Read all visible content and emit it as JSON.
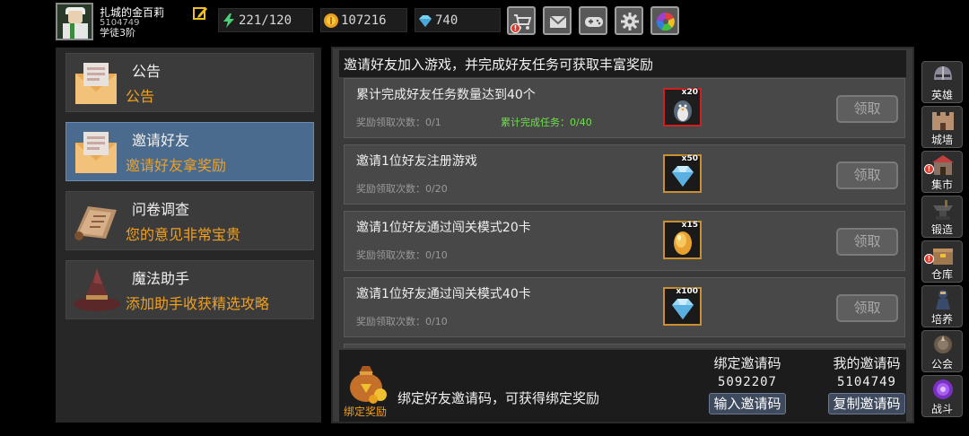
{
  "player": {
    "name": "扎城的金百莉",
    "id": "5104749",
    "group": "学徒3阶"
  },
  "resources": {
    "energy": "221/120",
    "gold": "107216",
    "gems": "740"
  },
  "toolbar": {
    "buttons": [
      "shop-icon",
      "mail-icon",
      "gamepad-icon",
      "gear-icon",
      "color-wheel-icon"
    ]
  },
  "sidebar": {
    "items": [
      {
        "title": "公告",
        "subtitle": "公告"
      },
      {
        "title": "邀请好友",
        "subtitle": "邀请好友拿奖励"
      },
      {
        "title": "问卷调查",
        "subtitle": "您的意见非常宝贵"
      },
      {
        "title": "魔法助手",
        "subtitle": "添加助手收获精选攻略"
      }
    ]
  },
  "main": {
    "header": "邀请好友加入游戏，并完成好友任务可获取丰富奖励",
    "tasks": [
      {
        "title": "累计完成好友任务数量达到40个",
        "claims": "奖励领取次数：0/1",
        "progress": "累计完成任务：0/40",
        "reward_qty": "x20",
        "reward_icon": "penguin-icon",
        "button": "领取"
      },
      {
        "title": "邀请1位好友注册游戏",
        "claims": "奖励领取次数：0/20",
        "reward_qty": "x50",
        "reward_icon": "diamond-icon",
        "button": "领取"
      },
      {
        "title": "邀请1位好友通过闯关模式20卡",
        "claims": "奖励领取次数：0/10",
        "reward_qty": "x15",
        "reward_icon": "golden-egg-icon",
        "button": "领取"
      },
      {
        "title": "邀请1位好友通过闯关模式40卡",
        "claims": "奖励领取次数：0/10",
        "reward_qty": "x100",
        "reward_icon": "diamond-icon",
        "button": "领取"
      }
    ],
    "bottom": {
      "bag_label": "绑定奖励",
      "bind_desc": "绑定好友邀请码，可获得绑定奖励",
      "bind_code_label": "绑定邀请码",
      "bind_code": "5092207",
      "bind_button": "输入邀请码",
      "my_code_label": "我的邀请码",
      "my_code": "5104749",
      "copy_button": "复制邀请码"
    }
  },
  "rightnav": {
    "items": [
      {
        "label": "英雄",
        "icon": "helmet-icon",
        "alert": false
      },
      {
        "label": "城墙",
        "icon": "wall-icon",
        "alert": false
      },
      {
        "label": "集市",
        "icon": "market-icon",
        "alert": true
      },
      {
        "label": "锻造",
        "icon": "anvil-icon",
        "alert": false
      },
      {
        "label": "仓库",
        "icon": "warehouse-icon",
        "alert": true
      },
      {
        "label": "培养",
        "icon": "training-icon",
        "alert": false
      },
      {
        "label": "公会",
        "icon": "guild-icon",
        "alert": false
      },
      {
        "label": "战斗",
        "icon": "portal-icon",
        "alert": false
      }
    ]
  },
  "colors": {
    "accent_orange": "#f0a020",
    "progress_green": "#6ee04a",
    "active_tab": "#4a6a8e"
  }
}
